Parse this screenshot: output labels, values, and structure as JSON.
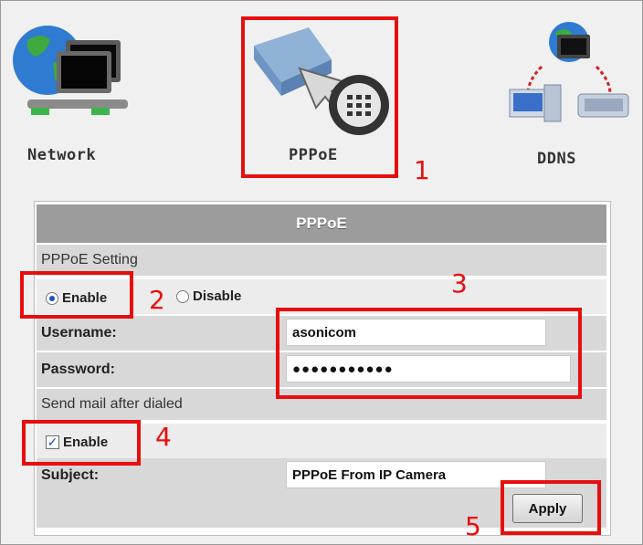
{
  "icons": [
    {
      "name": "network",
      "label": "Network"
    },
    {
      "name": "pppoe",
      "label": "PPPoE"
    },
    {
      "name": "ddns",
      "label": "DDNS"
    }
  ],
  "form": {
    "title": "PPPoE",
    "pppoe_section": "PPPoE Setting",
    "enable_label": "Enable",
    "disable_label": "Disable",
    "pppoe_enabled": true,
    "username_label": "Username:",
    "username_value": "asonicom",
    "password_label": "Password:",
    "password_value": "●●●●●●●●●●●",
    "mail_section": "Send mail after dialed",
    "mail_enable_label": "Enable",
    "mail_enabled": true,
    "subject_label": "Subject:",
    "subject_value": "PPPoE From IP Camera",
    "apply_label": "Apply"
  },
  "annotations": [
    "1",
    "2",
    "3",
    "4",
    "5"
  ],
  "colors": {
    "annotation_red": "#e80e0e",
    "header_gray": "#9c9c9c",
    "section_gray": "#d8d8d8"
  }
}
